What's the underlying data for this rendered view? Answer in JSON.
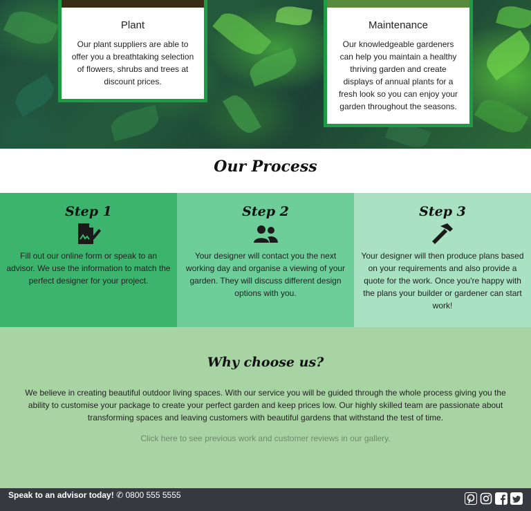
{
  "cards": [
    {
      "title": "Plant",
      "body": "Our plant suppliers are able to offer you a breathtaking selection of flowers, shrubs and trees at discount prices."
    },
    {
      "title": "Maintenance",
      "body": "Our knowledgeable gardeners can help you maintain a healthy thriving garden and create displays of annual plants for a fresh look so you can enjoy your garden throughout the seasons."
    }
  ],
  "process": {
    "title": "Our Process",
    "steps": [
      {
        "title": "Step 1",
        "icon": "form-signature-icon",
        "text": "Fill out our online form or speak to an advisor. We use the information to match the perfect designer for your project.",
        "color": "#3cb46e"
      },
      {
        "title": "Step 2",
        "icon": "users-icon",
        "text": "Your designer will contact you the next working day and organise a viewing of your garden. They will discuss different design options with you.",
        "color": "#6dce9a"
      },
      {
        "title": "Step 3",
        "icon": "hammer-icon",
        "text": "Your designer will then produce plans based on your requirements and also provide a quote for the work. Once you're happy with the plans your builder or gardener can start work!",
        "color": "#a8e2c2"
      }
    ]
  },
  "why": {
    "title": "Why choose us?",
    "body": "We believe in creating beautiful outdoor living spaces. With our service you will be guided through the whole process giving you the ability to customise your package to create your perfect garden and keep prices low. Our highly skilled team are passionate about transforming spaces and leaving customers with beautiful gardens that withstand the test of time.",
    "link": "Click here to see previous work and customer reviews in our gallery."
  },
  "footer": {
    "cta": "Speak to an advisor today!",
    "phone": "0800 555 5555",
    "social": [
      "pinterest-icon",
      "instagram-icon",
      "facebook-icon",
      "twitter-icon"
    ]
  },
  "colors": {
    "accent": "#1f9a45",
    "why_bg": "#a8d4a4",
    "footer_bg": "#363940"
  }
}
